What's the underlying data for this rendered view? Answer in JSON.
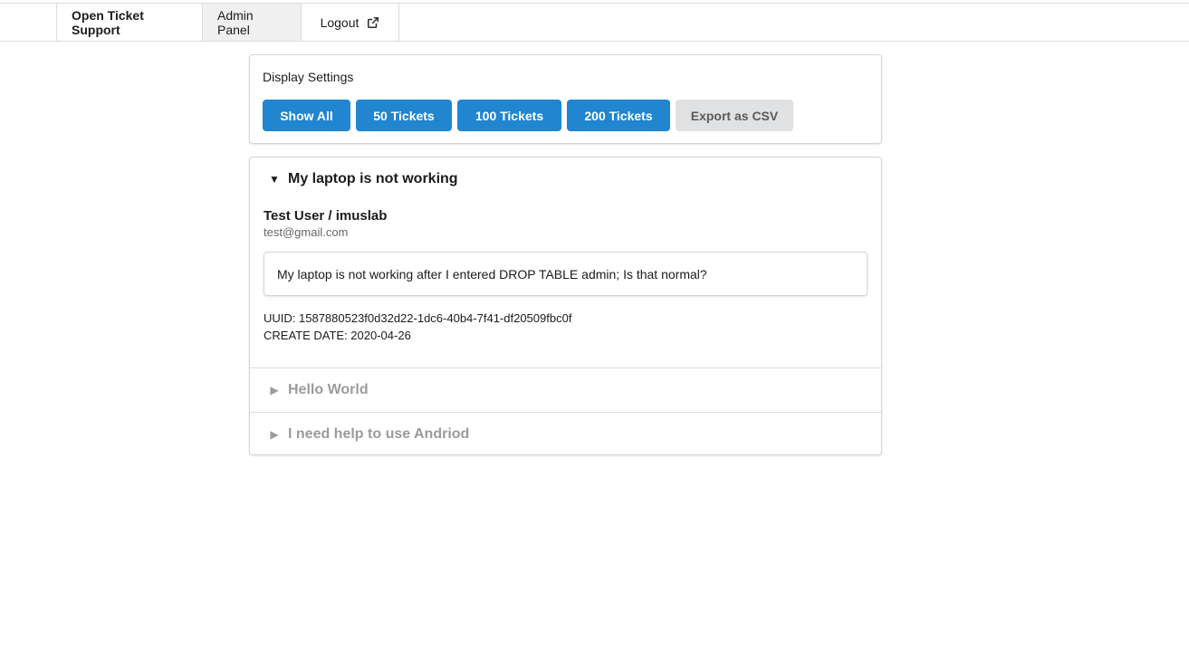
{
  "nav": {
    "brand": "Open Ticket Support",
    "admin_panel": "Admin Panel",
    "logout": "Logout",
    "logout_icon": "external-link-icon"
  },
  "settings": {
    "title": "Display Settings",
    "buttons": [
      {
        "label": "Show All"
      },
      {
        "label": "50 Tickets"
      },
      {
        "label": "100 Tickets"
      },
      {
        "label": "200 Tickets"
      },
      {
        "label": "Export as CSV"
      }
    ],
    "colors": {
      "primary": "#2185d0",
      "secondary": "#e0e1e2"
    }
  },
  "tickets": [
    {
      "title": "My laptop is not working",
      "expanded": true,
      "user": "Test User / imuslab",
      "email": "test@gmail.com",
      "message": "My laptop is not working after I entered DROP TABLE admin; Is that normal?",
      "uuid_line": "UUID: 1587880523f0d32d22-1dc6-40b4-7f41-df20509fbc0f",
      "date_line": "CREATE DATE: 2020-04-26"
    },
    {
      "title": "Hello World",
      "expanded": false
    },
    {
      "title": "I need help to use Andriod",
      "expanded": false
    }
  ]
}
